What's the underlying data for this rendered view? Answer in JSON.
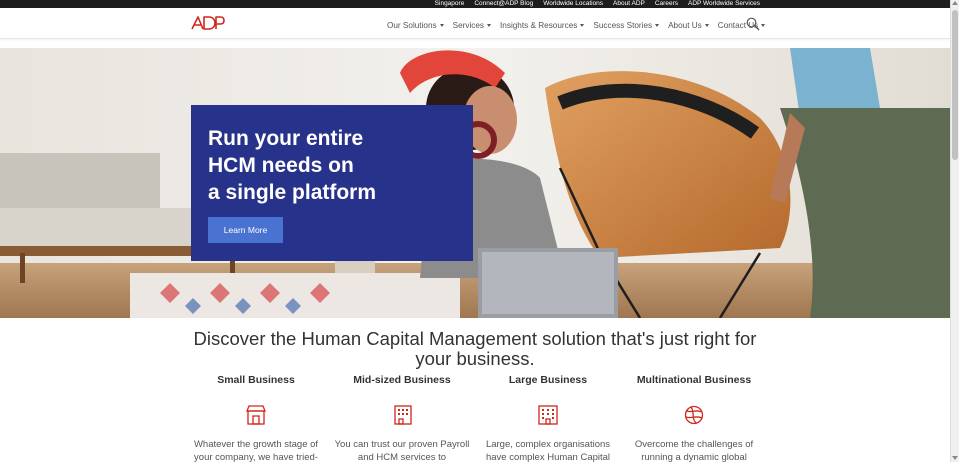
{
  "utility_links": [
    "Singapore",
    "Connect@ADP Blog",
    "Worldwide Locations",
    "About ADP",
    "Careers",
    "ADP Worldwide Services"
  ],
  "brand": {
    "logo_text": "ADP",
    "color": "#d0271d"
  },
  "nav": [
    "Our Solutions",
    "Services",
    "Insights & Resources",
    "Success Stories",
    "About Us",
    "Contact Us"
  ],
  "search": {
    "icon": "search-icon"
  },
  "hero": {
    "title": "Run your entire\nHCM needs on\na single platform",
    "button": "Learn More",
    "card_color": "#27328a",
    "button_color": "#4a72d0"
  },
  "discover": {
    "title": "Discover the Human Capital Management solution that's just right for your business.",
    "columns": [
      {
        "title": "Small Business",
        "icon": "store-icon",
        "desc": "Whatever the growth stage of your company, we have tried-"
      },
      {
        "title": "Mid-sized Business",
        "icon": "office-building-icon",
        "desc": "You can trust our proven Payroll and HCM services to"
      },
      {
        "title": "Large Business",
        "icon": "large-building-icon",
        "desc": "Large, complex organisations have complex Human Capital"
      },
      {
        "title": "Multinational Business",
        "icon": "globe-icon",
        "desc": "Overcome the challenges of running a dynamic global"
      }
    ]
  },
  "colors": {
    "accent": "#d0271d",
    "text": "#333333"
  }
}
